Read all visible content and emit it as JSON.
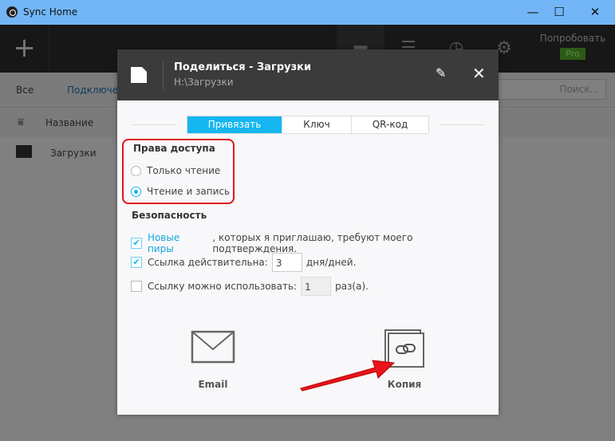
{
  "window": {
    "title": "Sync Home",
    "minimize": "—",
    "maximize": "☐",
    "close": "✕"
  },
  "topbar": {
    "add": "+",
    "try": "Попробовать",
    "pro": "Pro",
    "icons": [
      "folder-icon",
      "list-icon",
      "clock-icon",
      "gear-icon"
    ]
  },
  "filter": {
    "all": "Все",
    "connected": "Подключе",
    "search_placeholder": "Поиск..."
  },
  "list": {
    "column_name": "Название",
    "rows": [
      {
        "name": "Загрузки"
      }
    ]
  },
  "dialog": {
    "title": "Поделиться - Загрузки",
    "path": "H:\\Загрузки",
    "tabs": [
      {
        "label": "Привязать",
        "active": true
      },
      {
        "label": "Ключ"
      },
      {
        "label": "QR-код"
      }
    ],
    "access": {
      "heading": "Права доступа",
      "read_only": "Только чтение",
      "read_write": "Чтение и запись",
      "selected": "read_write"
    },
    "security": {
      "heading": "Безопасность",
      "peers_link": "Новые пиры",
      "peers_text": ", которых я приглашаю, требуют моего подтверждения.",
      "peers_checked": true,
      "valid_label": "Ссылка действительна:",
      "valid_value": "3",
      "valid_unit": "дня/дней.",
      "valid_checked": true,
      "uses_label": "Ссылку можно использовать:",
      "uses_value": "1",
      "uses_unit": "раз(а).",
      "uses_checked": false
    },
    "email": "Email",
    "copy": "Копия"
  },
  "colors": {
    "accent": "#16b6f0",
    "annotation": "#e0141c",
    "titlebar": "#72b6f7"
  }
}
